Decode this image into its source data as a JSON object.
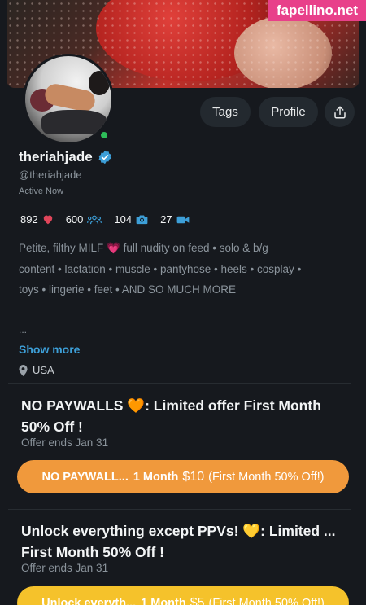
{
  "watermark": "fapellino.net",
  "actions": {
    "tags_label": "Tags",
    "profile_label": "Profile"
  },
  "profile": {
    "name": "theriahjade",
    "handle": "@theriahjade",
    "status": "Active Now"
  },
  "stats": [
    {
      "value": "892",
      "icon": "heart-icon",
      "color": "#e0455a"
    },
    {
      "value": "600",
      "icon": "fans-icon",
      "color": "#3d9fd8"
    },
    {
      "value": "104",
      "icon": "camera-icon",
      "color": "#3d9fd8"
    },
    {
      "value": "27",
      "icon": "video-icon",
      "color": "#3d9fd8"
    }
  ],
  "bio": {
    "line1_before": "Petite, filthy MILF",
    "line1_emoji": "💗",
    "line1_after": "full nudity on feed • solo & b/g",
    "line2": "content • lactation • muscle • pantyhose • heels • cosplay •",
    "line3": "toys • lingerie • feet • AND SO MUCH MORE",
    "ellipsis": "...",
    "show_more": "Show more",
    "location": "USA"
  },
  "offers": [
    {
      "title_before": "NO PAYWALLS",
      "title_emoji": "🧡",
      "title_after": ": Limited offer First Month",
      "title_line2": "50% Off !",
      "ends": "Offer ends Jan 31",
      "cta_name": "NO PAYWALL...",
      "cta_duration": "1 Month",
      "cta_price": "$10",
      "cta_note": "(First Month 50% Off!)"
    },
    {
      "title_before": "Unlock everything except PPVs!",
      "title_emoji": "💛",
      "title_after": ": Limited ...",
      "title_line2": "First Month 50% Off !",
      "ends": "Offer ends Jan 31",
      "cta_name": "Unlock everyth...",
      "cta_duration": "1 Month",
      "cta_price": "$5",
      "cta_note": "(First Month 50% Off!)"
    }
  ],
  "colors": {
    "background": "#16191e",
    "accent_blue": "#3d9fd8",
    "cta_orange": "#f0993c",
    "cta_yellow": "#f5c22b",
    "online": "#2ebd59"
  }
}
